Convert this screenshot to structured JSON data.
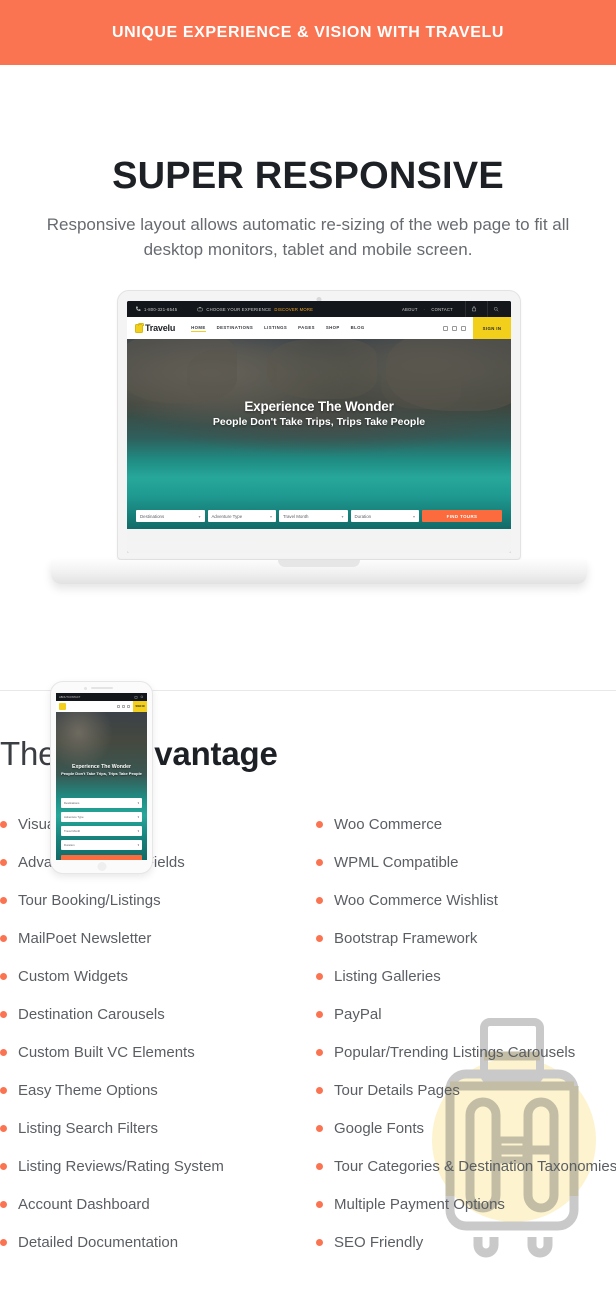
{
  "banner": {
    "text": "Unique Experience & Vision with Travelu",
    "bg": "#fb7452",
    "color": "#ffffff"
  },
  "hero": {
    "title": "SUPER RESPONSIVE",
    "subtitle": "Responsive layout allows automatic re-sizing of the web page to fit all desktop monitors, tablet and mobile screen."
  },
  "mockup": {
    "site": {
      "topbar": {
        "phone": "1-800-321-6545",
        "tagline": "CHOOSE YOUR EXPERIENCE",
        "cta": "DISCOVER MORE",
        "links": [
          "ABOUT",
          "CONTACT"
        ],
        "separator": "-",
        "icons": [
          "phone-icon",
          "suitcase-icon",
          "cart-icon",
          "search-icon"
        ]
      },
      "brand": "Travelu",
      "nav": [
        "HOME",
        "DESTINATIONS",
        "LISTINGS",
        "PAGES",
        "SHOP",
        "BLOG"
      ],
      "active_nav": "HOME",
      "social": [
        "facebook-icon",
        "instagram-icon",
        "twitter-icon"
      ],
      "signin": "SIGN IN",
      "hero_title": "Experience The Wonder",
      "hero_subtitle": "People Don't Take Trips, Trips Take People",
      "search": {
        "fields": [
          "Destinations",
          "Adventure Type",
          "Travel Month",
          "Duration"
        ],
        "button": "FIND TOURS",
        "button_color": "#fb6b3d"
      }
    }
  },
  "advantage": {
    "title_light": "Theme",
    "title_bold": "Advantage",
    "bullet_color": "#fb7452",
    "left_column": [
      "Visual Composer",
      "Advanced Custom Fields",
      "Tour Booking/Listings",
      "MailPoet Newsletter",
      "Custom Widgets",
      "Destination Carousels",
      "Custom Built VC Elements",
      "Easy Theme Options",
      "Listing Search Filters",
      "Listing Reviews/Rating System",
      "Account Dashboard",
      "Detailed Documentation"
    ],
    "right_column": [
      "Woo Commerce",
      "WPML Compatible",
      "Woo Commerce Wishlist",
      "Bootstrap Framework",
      "Listing Galleries",
      "PayPal",
      "Popular/Trending Listings Carousels",
      "Tour Details Pages",
      "Google Fonts",
      "Tour Categories & Destination Taxonomies",
      "Multiple Payment Options",
      "SEO Friendly"
    ]
  }
}
